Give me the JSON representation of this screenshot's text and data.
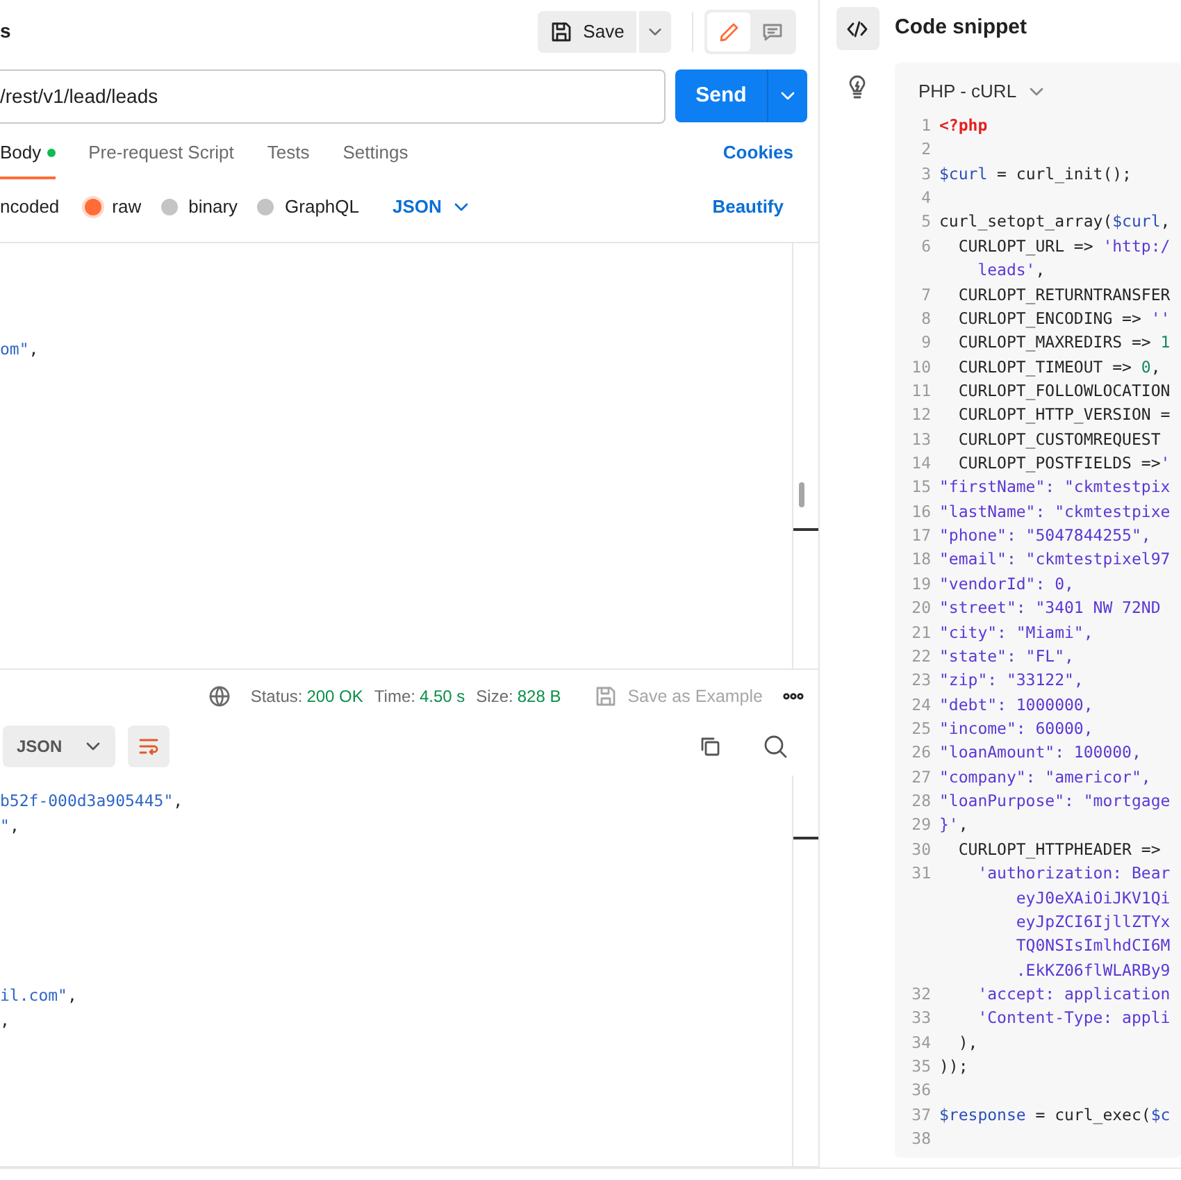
{
  "request": {
    "title_fragment": "s",
    "save_label": "Save",
    "url": "/rest/v1/lead/leads",
    "send_label": "Send"
  },
  "mode_toggle": [
    {
      "kind": "edit",
      "selected": true
    },
    {
      "kind": "comment",
      "selected": false
    }
  ],
  "tabs": [
    {
      "label": "Body",
      "selected": true,
      "dot": true
    },
    {
      "label": "Pre-request Script",
      "selected": false,
      "dot": false
    },
    {
      "label": "Tests",
      "selected": false,
      "dot": false
    },
    {
      "label": "Settings",
      "selected": false,
      "dot": false
    }
  ],
  "cookies_link": "Cookies",
  "body_types": [
    {
      "kind": "text",
      "label": "ncoded"
    },
    {
      "kind": "radio",
      "label": "raw",
      "selected": true
    },
    {
      "kind": "radio",
      "label": "binary",
      "selected": false
    },
    {
      "kind": "radio",
      "label": "GraphQL",
      "selected": false
    }
  ],
  "body_language": "JSON",
  "beautify_link": "Beautify",
  "request_body": {
    "lines": [
      {
        "segments": [
          {
            "kind": "string",
            "text": "om\""
          },
          {
            "kind": "plain",
            "text": ","
          }
        ]
      }
    ]
  },
  "response": {
    "status_label": "Status:",
    "status": "200 OK",
    "time_label": "Time:",
    "time": "4.50 s",
    "size_label": "Size:",
    "size": "828 B",
    "save_example": {
      "label": "Save as Example",
      "disabled": true
    },
    "format": "JSON",
    "lines": [
      {
        "segments": [
          {
            "kind": "string",
            "text": "b52f-000d3a905445\""
          },
          {
            "kind": "plain",
            "text": ","
          }
        ]
      },
      {
        "segments": [
          {
            "kind": "string",
            "text": "\""
          },
          {
            "kind": "plain",
            "text": ","
          }
        ]
      },
      {
        "segments": [
          {
            "kind": "string",
            "text": "il.com\""
          },
          {
            "kind": "plain",
            "text": ","
          }
        ]
      },
      {
        "segments": [
          {
            "kind": "plain",
            "text": ","
          }
        ]
      }
    ]
  },
  "snippet_panel": {
    "title": "Code snippet",
    "language": "PHP - cURL",
    "lines": [
      {
        "num": "1",
        "segments": [
          {
            "kind": "tag",
            "text": "<?php"
          }
        ]
      },
      {
        "num": "2"
      },
      {
        "num": "3",
        "segments": [
          {
            "kind": "variable",
            "text": "$curl"
          },
          {
            "kind": "plain",
            "text": " = curl_init();"
          }
        ]
      },
      {
        "num": "4"
      },
      {
        "num": "5",
        "segments": [
          {
            "kind": "plain",
            "text": "curl_setopt_array("
          },
          {
            "kind": "variable",
            "text": "$curl"
          },
          {
            "kind": "plain",
            "text": ","
          }
        ]
      },
      {
        "num": "6",
        "segments": [
          {
            "kind": "plain",
            "text": "  CURLOPT_URL => "
          },
          {
            "kind": "string",
            "text": "'http:/"
          }
        ]
      },
      {
        "segments": [
          {
            "kind": "string",
            "text": "    leads'"
          },
          {
            "kind": "plain",
            "text": ","
          }
        ]
      },
      {
        "num": "7",
        "segments": [
          {
            "kind": "plain",
            "text": "  CURLOPT_RETURNTRANSFER"
          }
        ]
      },
      {
        "num": "8",
        "segments": [
          {
            "kind": "plain",
            "text": "  CURLOPT_ENCODING => "
          },
          {
            "kind": "string",
            "text": "''"
          }
        ]
      },
      {
        "num": "9",
        "segments": [
          {
            "kind": "plain",
            "text": "  CURLOPT_MAXREDIRS => "
          },
          {
            "kind": "number",
            "text": "1"
          }
        ]
      },
      {
        "num": "10",
        "segments": [
          {
            "kind": "plain",
            "text": "  CURLOPT_TIMEOUT => "
          },
          {
            "kind": "number",
            "text": "0"
          },
          {
            "kind": "plain",
            "text": ","
          }
        ]
      },
      {
        "num": "11",
        "segments": [
          {
            "kind": "plain",
            "text": "  CURLOPT_FOLLOWLOCATION"
          }
        ]
      },
      {
        "num": "12",
        "segments": [
          {
            "kind": "plain",
            "text": "  CURLOPT_HTTP_VERSION ="
          }
        ]
      },
      {
        "num": "13",
        "segments": [
          {
            "kind": "plain",
            "text": "  CURLOPT_CUSTOMREQUEST"
          }
        ]
      },
      {
        "num": "14",
        "segments": [
          {
            "kind": "plain",
            "text": "  CURLOPT_POSTFIELDS =>"
          },
          {
            "kind": "string",
            "text": "'"
          }
        ]
      },
      {
        "num": "15",
        "segments": [
          {
            "kind": "string",
            "text": "\"firstName\": \"ckmtestpix"
          }
        ]
      },
      {
        "num": "16",
        "segments": [
          {
            "kind": "string",
            "text": "\"lastName\": \"ckmtestpixe"
          }
        ]
      },
      {
        "num": "17",
        "segments": [
          {
            "kind": "string",
            "text": "\"phone\": \"5047844255\","
          }
        ]
      },
      {
        "num": "18",
        "segments": [
          {
            "kind": "string",
            "text": "\"email\": \"ckmtestpixel97"
          }
        ]
      },
      {
        "num": "19",
        "segments": [
          {
            "kind": "string",
            "text": "\"vendorId\": 0,"
          }
        ]
      },
      {
        "num": "20",
        "segments": [
          {
            "kind": "string",
            "text": "\"street\": \"3401 NW 72ND"
          }
        ]
      },
      {
        "num": "21",
        "segments": [
          {
            "kind": "string",
            "text": "\"city\": \"Miami\","
          }
        ]
      },
      {
        "num": "22",
        "segments": [
          {
            "kind": "string",
            "text": "\"state\": \"FL\","
          }
        ]
      },
      {
        "num": "23",
        "segments": [
          {
            "kind": "string",
            "text": "\"zip\": \"33122\","
          }
        ]
      },
      {
        "num": "24",
        "segments": [
          {
            "kind": "string",
            "text": "\"debt\": 1000000,"
          }
        ]
      },
      {
        "num": "25",
        "segments": [
          {
            "kind": "string",
            "text": "\"income\": 60000,"
          }
        ]
      },
      {
        "num": "26",
        "segments": [
          {
            "kind": "string",
            "text": "\"loanAmount\": 100000,"
          }
        ]
      },
      {
        "num": "27",
        "segments": [
          {
            "kind": "string",
            "text": "\"company\": \"americor\","
          }
        ]
      },
      {
        "num": "28",
        "segments": [
          {
            "kind": "string",
            "text": "\"loanPurpose\": \"mortgage"
          }
        ]
      },
      {
        "num": "29",
        "segments": [
          {
            "kind": "string",
            "text": "}'"
          },
          {
            "kind": "plain",
            "text": ","
          }
        ]
      },
      {
        "num": "30",
        "segments": [
          {
            "kind": "plain",
            "text": "  CURLOPT_HTTPHEADER =>"
          }
        ]
      },
      {
        "num": "31",
        "segments": [
          {
            "kind": "string",
            "text": "    'authorization: Bear"
          }
        ]
      },
      {
        "segments": [
          {
            "kind": "string",
            "text": "        eyJ0eXAiOiJKV1Qi"
          }
        ]
      },
      {
        "segments": [
          {
            "kind": "string",
            "text": "        eyJpZCI6IjllZTYx"
          }
        ]
      },
      {
        "segments": [
          {
            "kind": "string",
            "text": "        TQ0NSIsImlhdCI6M"
          }
        ]
      },
      {
        "segments": [
          {
            "kind": "string",
            "text": "        .EkKZ06flWLARBy9"
          }
        ]
      },
      {
        "num": "32",
        "segments": [
          {
            "kind": "string",
            "text": "    'accept: application"
          }
        ]
      },
      {
        "num": "33",
        "segments": [
          {
            "kind": "string",
            "text": "    'Content-Type: appli"
          }
        ]
      },
      {
        "num": "34",
        "segments": [
          {
            "kind": "plain",
            "text": "  ),"
          }
        ]
      },
      {
        "num": "35",
        "segments": [
          {
            "kind": "plain",
            "text": "));"
          }
        ]
      },
      {
        "num": "36"
      },
      {
        "num": "37",
        "segments": [
          {
            "kind": "variable",
            "text": "$response"
          },
          {
            "kind": "plain",
            "text": " = curl_exec("
          },
          {
            "kind": "variable",
            "text": "$c"
          }
        ]
      },
      {
        "num": "38"
      }
    ]
  }
}
